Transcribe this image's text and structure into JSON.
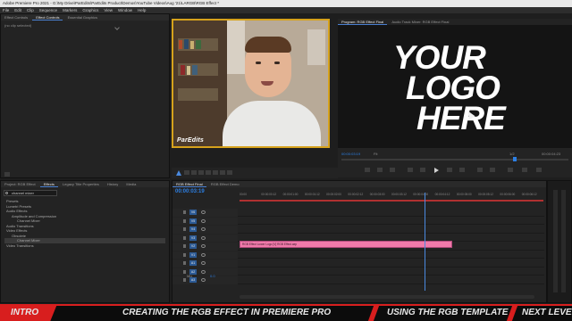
{
  "app": {
    "title": "Adobe Premiere Pro 2021 - G:\\My Drive\\ParEdits\\ParEdits Product\\Demos\\YouTube Videos\\Aug '21\\LARGB\\RGB Effect *"
  },
  "menu": [
    "File",
    "Edit",
    "Clip",
    "Sequence",
    "Markers",
    "Graphics",
    "View",
    "Window",
    "Help"
  ],
  "top_left_panel": {
    "tabs": [
      "Effect Controls",
      "Effect Controls",
      "Essential Graphics"
    ],
    "message": "(no clip selected)"
  },
  "webcam": {
    "watermark": "ParEdits"
  },
  "program_monitor": {
    "tabs": [
      "Program: RGB Effect Final",
      "Audio Track Mixer: RGB Effect Final"
    ],
    "logo_lines": [
      "YOUR",
      "LOGO",
      "HERE"
    ],
    "timecode_left": "00:00:03:19",
    "fit": "Fit",
    "resolution": "1/2",
    "timecode_right": "00:00:04:23"
  },
  "project_panel": {
    "tabs": [
      "Project: RGB Effect",
      "Effects",
      "Legacy Title Properties",
      "History",
      "Media"
    ],
    "search_value": "channel mixer",
    "tree": [
      "Presets",
      "Lumetri Presets",
      "Audio Effects",
      "Amplitude and Compression",
      "Channel Mixer",
      "Audio Transitions",
      "Video Effects",
      "Obsolete",
      "Channel Mixer",
      "Video Transitions"
    ]
  },
  "timeline": {
    "tabs": [
      "RGB Effect Final",
      "RGB Effect Demo"
    ],
    "timecode": "00:00:03:19",
    "ruler": [
      "00:00",
      "00:00:00:12",
      "00:00:01:00",
      "00:00:01:12",
      "00:00:02:00",
      "00:00:02:12",
      "00:00:03:00",
      "00:00:03:12",
      "00:00:04:00",
      "00:00:04:12",
      "00:00:05:00",
      "00:00:05:12",
      "00:00:06:00",
      "00:00:06:12"
    ],
    "video_tracks": [
      "V6",
      "V5",
      "V4",
      "V3",
      "V2",
      "V1"
    ],
    "audio_tracks": [
      "A1",
      "A2",
      "A3"
    ],
    "mix_label": "Mix",
    "mix_value": "0.0",
    "clip_label": "RGB Effect Lower Logo [V] RGB Effect.aep",
    "playhead_fraction": 0.61
  },
  "banner": {
    "segments": [
      "INTRO",
      "CREATING THE RGB EFFECT IN PREMIERE PRO",
      "USING THE RGB TEMPLATE",
      "NEXT LEVEL"
    ]
  },
  "colors": {
    "accent": "#d81e1e",
    "clip": "#f07aaa",
    "webcam_border": "#d6a21c",
    "timecode": "#2c7fe3"
  }
}
